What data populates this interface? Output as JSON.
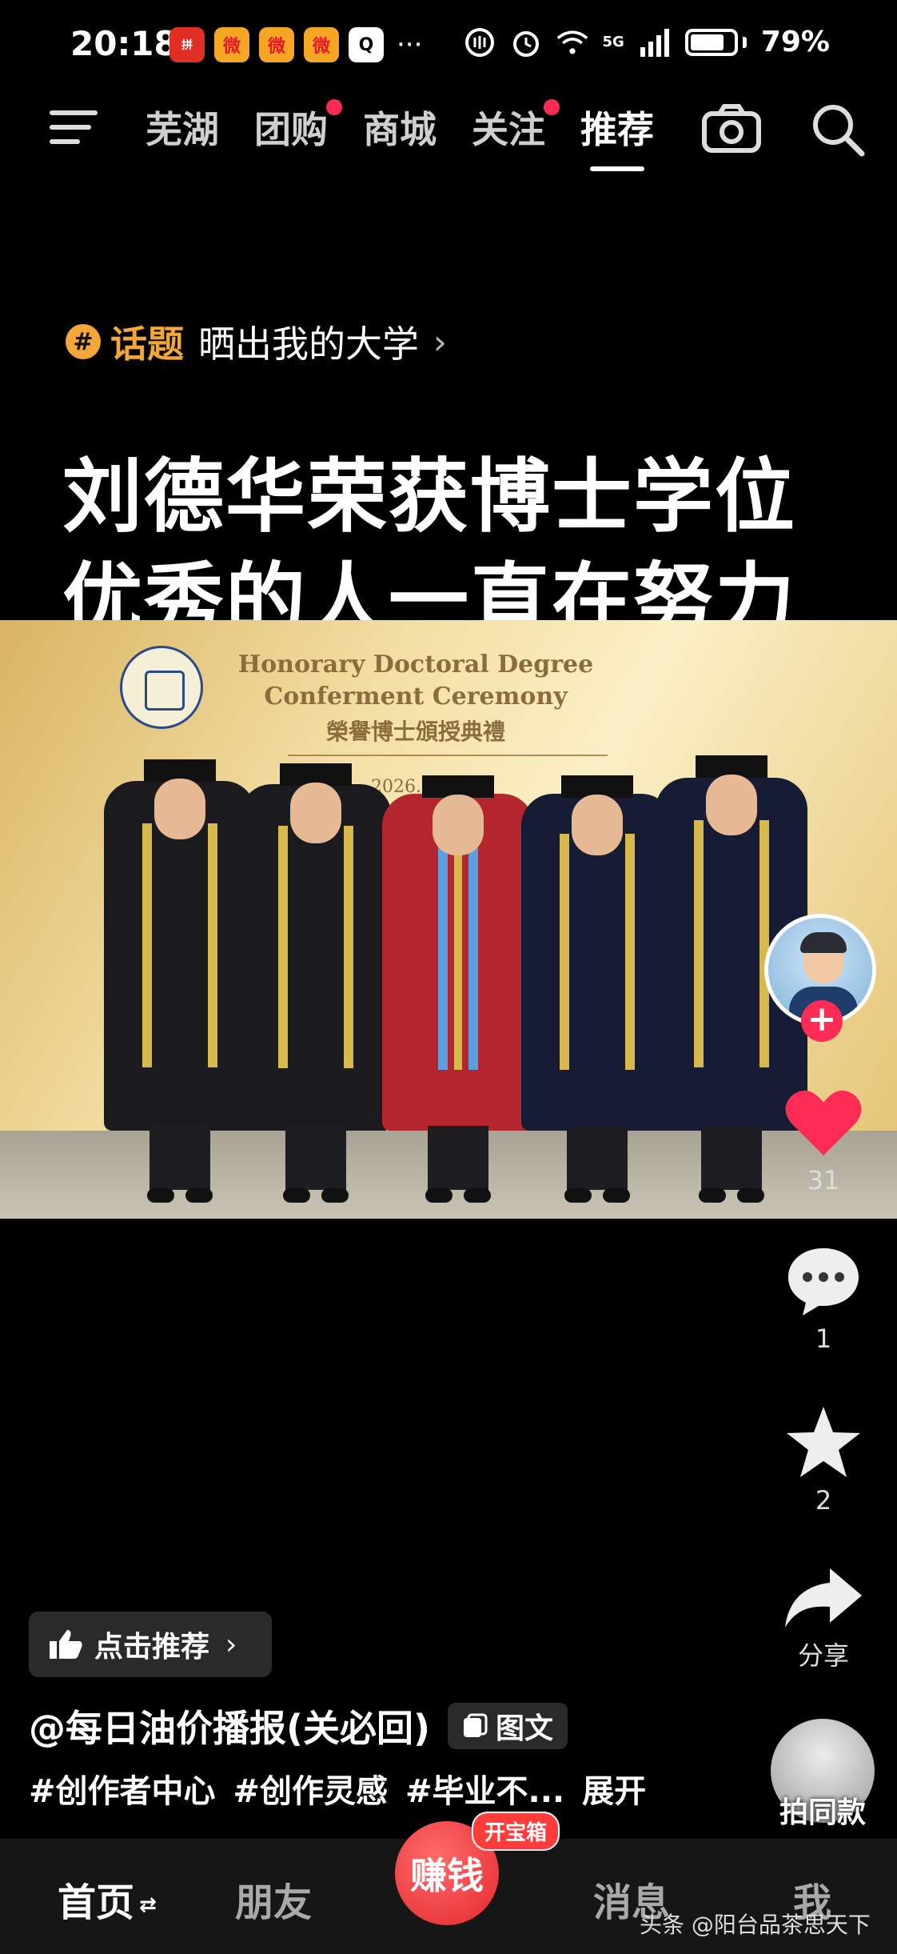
{
  "status_bar": {
    "time": "20:18",
    "apps": [
      "pinduoduo-icon",
      "weibo-icon",
      "weibo-icon",
      "weibo-icon",
      "qq-icon"
    ],
    "more": "···",
    "network": "5G",
    "battery_percent": "79%",
    "battery_level": 0.79
  },
  "nav": {
    "tabs": [
      {
        "label": "芜湖"
      },
      {
        "label": "团购"
      },
      {
        "label": "商城"
      },
      {
        "label": "关注"
      },
      {
        "label": "推荐"
      }
    ],
    "active_tab": "推荐"
  },
  "topic": {
    "label": "话题",
    "name": "晒出我的大学"
  },
  "post": {
    "headline_line1": "刘德华荣获博士学位",
    "headline_line2": "优秀的人一直在努力",
    "photo": {
      "line1": "Honorary Doctoral Degree",
      "line2": "Conferment Ceremony",
      "line3": "榮譽博士頒授典禮",
      "date": "2026.8.10"
    }
  },
  "actions": {
    "likes": "31",
    "comments": "1",
    "favorites": "2",
    "share_label": "分享"
  },
  "info": {
    "recommend_label": "点击推荐",
    "author": "@每日油价播报(关必回)",
    "type_label": "图文",
    "hashtags": [
      "#创作者中心",
      "#创作灵感",
      "#毕业不..."
    ],
    "expand_label": "展开",
    "same_style_label": "拍同款"
  },
  "bottom_nav": {
    "home": "首页",
    "friends": "朋友",
    "earn": "赚钱",
    "earn_tag": "开宝箱",
    "messages": "消息",
    "me": "我"
  },
  "watermark": "头条 @阳台品茶思天下",
  "colors": {
    "accent_red": "#fe2c55",
    "topic_orange": "#f3a73b"
  }
}
